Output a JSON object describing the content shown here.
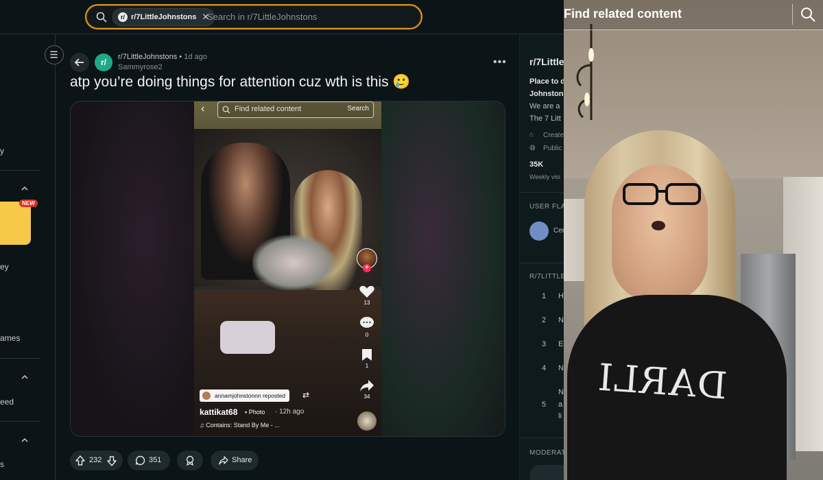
{
  "search": {
    "chip_label": "r/7LittleJohnstons",
    "chip_icon": "subreddit-icon",
    "placeholder": "Search in r/7LittleJohnstons",
    "border_color": "#d99a1c"
  },
  "left_sidebar": {
    "fragments": [
      "y",
      "NEW",
      "s",
      "ey",
      "ames",
      "eed",
      "s"
    ]
  },
  "post": {
    "subreddit": "r/7LittleJohnstons",
    "separator": "•",
    "time": "1d ago",
    "author": "Sammyrose2",
    "avatar_letter": "r/",
    "more": "•••",
    "title": "atp you’re doing things for attention cuz wth is this 🥲",
    "accent": "#1fa986"
  },
  "embedded_tiktok": {
    "search_placeholder": "Find related content",
    "search_button": "Search",
    "likes": "13",
    "comments": "0",
    "saves": "1",
    "shares": "34",
    "repost_label": "annamjohnstonnn reposted",
    "username": "kattikat68",
    "photo_label": "Photo",
    "time": "· 12h ago",
    "music": "♫ Contains: Stand By Me - ..."
  },
  "actions": {
    "upvotes": "232",
    "comments": "351",
    "share_label": "Share"
  },
  "right_sidebar": {
    "title": "r/7Little",
    "desc_bold_1": "Place to d",
    "desc_bold_2": "Johnston",
    "desc_1": "We are a",
    "desc_2": "The 7 Litt",
    "created": "Create",
    "public": "Public",
    "members": "35K",
    "weekly": "Weekly visi",
    "user_flair_header": "USER FLAI",
    "flair_name": "Cer",
    "rules_header": "R/7LITTLE",
    "rules": [
      {
        "num": "1",
        "text": "H"
      },
      {
        "num": "2",
        "text": "N"
      },
      {
        "num": "3",
        "text": "E"
      },
      {
        "num": "4",
        "text": "N"
      },
      {
        "num": "5",
        "text": "N"
      }
    ],
    "rule5_extra": [
      "a",
      "li"
    ],
    "moderators_header": "MODERATO"
  },
  "video_overlay": {
    "search_placeholder": "Find related content",
    "shirt_text": "DARLI"
  }
}
